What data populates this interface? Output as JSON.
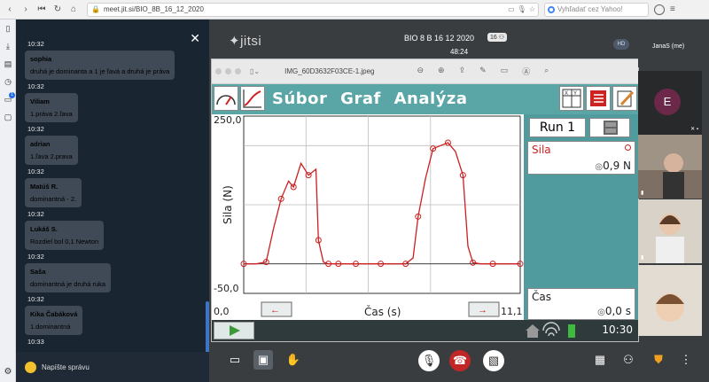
{
  "browser": {
    "url": "meet.jit.si/BIO_8B_16_12_2020",
    "search_placeholder": "Vyhľadať cez Yahoo!"
  },
  "chat": {
    "top_time": "10:32",
    "messages": [
      {
        "name": "sophia",
        "text": "druhá je dominanta a 1 je ľavá a druhá je práva",
        "time": "10:32"
      },
      {
        "name": "Viliam",
        "text": "1.práva 2.ľava",
        "time": "10:32"
      },
      {
        "name": "adrian",
        "text": "1.ľava 2.prava",
        "time": "10:32"
      },
      {
        "name": "Matúš R.",
        "text": "dominantná - 2.",
        "time": "10:32"
      },
      {
        "name": "Lukáš S.",
        "text": "Rozdiel bol 0,1 Newton",
        "time": "10:32"
      },
      {
        "name": "Saša",
        "text": "dominantná je druhá ruka",
        "time": "10:32"
      },
      {
        "name": "Kika Čabáková",
        "text": "1.dominantná",
        "time": "10:33"
      }
    ],
    "input_placeholder": "Napíšte správu",
    "notification_count": "1"
  },
  "conference": {
    "logo": "jitsi",
    "title": "BIO 8 B 16 12 2020",
    "participants": "16",
    "elapsed": "48:24",
    "hd_label": "HD",
    "self_name": "JanaS (me)",
    "avatar_letter": "E"
  },
  "viewer": {
    "filename": "IMG_60D3632F03CE-1.jpeg"
  },
  "labquest": {
    "menu": "Súbor Graf Analýza",
    "run": "Run 1",
    "sensor_name": "Sila",
    "sensor_value": "0,9 N",
    "time_name": "Čas",
    "time_value": "0,0 s",
    "clock": "10:30"
  },
  "chart_data": {
    "type": "line",
    "title": "",
    "xlabel": "Čas (s)",
    "ylabel": "Sila (N)",
    "x_tick_labels": [
      "0,0",
      "11,1"
    ],
    "y_tick_labels": [
      "250,0",
      "-50,0"
    ],
    "xlim": [
      0,
      11.1
    ],
    "ylim": [
      -50,
      250
    ],
    "grid": true,
    "series": [
      {
        "color": "#cc1f1f",
        "x": [
          0,
          0.5,
          0.9,
          1.2,
          1.5,
          1.8,
          2.0,
          2.3,
          2.6,
          2.9,
          3.0,
          3.2,
          3.4,
          3.6,
          3.8,
          4.0,
          4.5,
          5.0,
          5.5,
          6.0,
          6.5,
          6.8,
          7.0,
          7.3,
          7.6,
          7.9,
          8.2,
          8.5,
          8.8,
          9.0,
          9.2,
          9.5,
          10.0,
          10.5,
          11.1
        ],
        "y": [
          0,
          0,
          3,
          60,
          110,
          140,
          130,
          170,
          150,
          160,
          40,
          3,
          0,
          0,
          0,
          0,
          0,
          0,
          0,
          0,
          0,
          10,
          80,
          145,
          195,
          200,
          205,
          190,
          150,
          30,
          2,
          0,
          0,
          0,
          0
        ]
      }
    ]
  }
}
